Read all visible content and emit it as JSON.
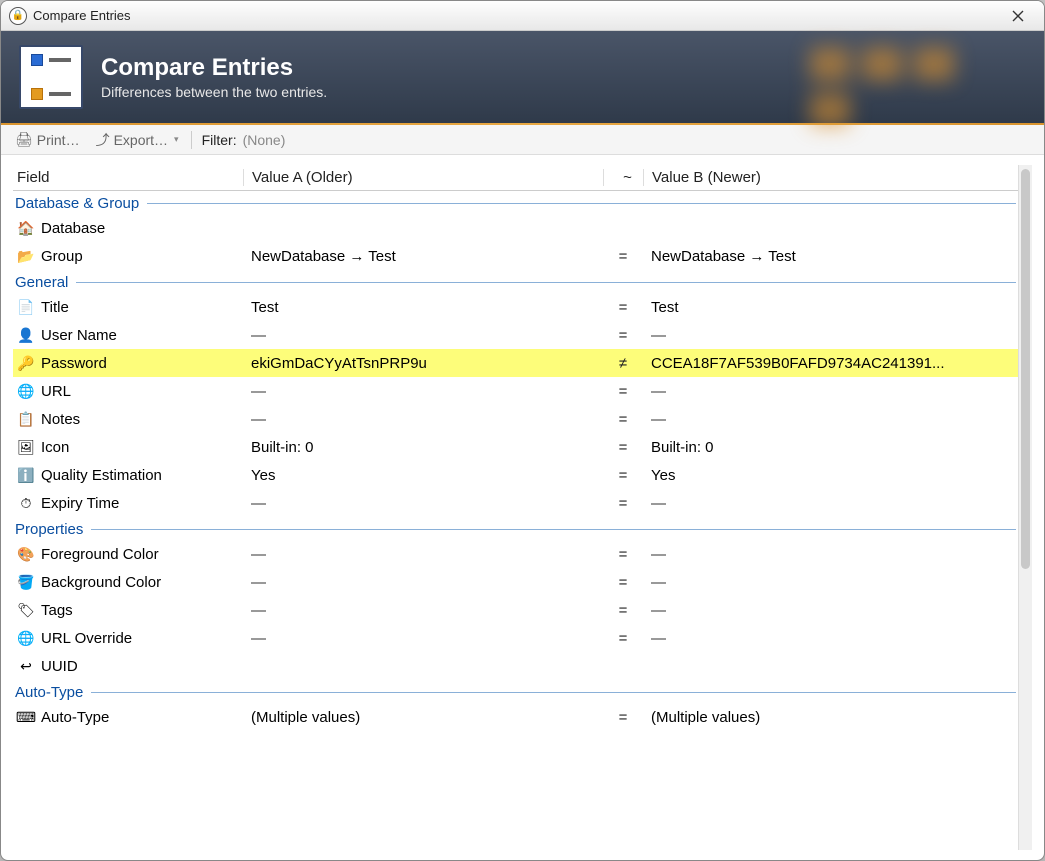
{
  "window": {
    "title": "Compare Entries"
  },
  "banner": {
    "title": "Compare Entries",
    "subtitle": "Differences between the two entries."
  },
  "toolbar": {
    "print_label": "Print…",
    "export_label": "Export…",
    "filter_label": "Filter:",
    "filter_value": "(None)"
  },
  "headers": {
    "field": "Field",
    "value_a": "Value A (Older)",
    "sym": "~",
    "value_b": "Value B (Newer)"
  },
  "sections": {
    "db_group": "Database & Group",
    "general": "General",
    "properties": "Properties",
    "autotype": "Auto-Type"
  },
  "rows": {
    "database": {
      "label": "Database",
      "a": "",
      "sym": "",
      "b": "",
      "icon": "🏠"
    },
    "group": {
      "label": "Group",
      "a": "NewDatabase → Test",
      "sym": "=",
      "b": "NewDatabase → Test",
      "icon": "📂"
    },
    "title": {
      "label": "Title",
      "a": "Test",
      "sym": "=",
      "b": "Test",
      "icon": "📄"
    },
    "username": {
      "label": "User Name",
      "a": "—",
      "sym": "=",
      "b": "—",
      "icon": "👤"
    },
    "password": {
      "label": "Password",
      "a": "ekiGmDaCYyAtTsnPRP9u",
      "sym": "≠",
      "b": "CCEA18F7AF539B0FAFD9734AC241391...",
      "icon": "🔑",
      "diff": true
    },
    "url": {
      "label": "URL",
      "a": "—",
      "sym": "=",
      "b": "—",
      "icon": "🌐"
    },
    "notes": {
      "label": "Notes",
      "a": "—",
      "sym": "=",
      "b": "—",
      "icon": "📋"
    },
    "iconrow": {
      "label": "Icon",
      "a": "Built-in: 0",
      "sym": "=",
      "b": "Built-in: 0",
      "icon": "🖼"
    },
    "quality": {
      "label": "Quality Estimation",
      "a": "Yes",
      "sym": "=",
      "b": "Yes",
      "icon": "ℹ"
    },
    "expiry": {
      "label": "Expiry Time",
      "a": "—",
      "sym": "=",
      "b": "—",
      "icon": "⏱"
    },
    "fgcolor": {
      "label": "Foreground Color",
      "a": "—",
      "sym": "=",
      "b": "—",
      "icon": "🎨"
    },
    "bgcolor": {
      "label": "Background Color",
      "a": "—",
      "sym": "=",
      "b": "—",
      "icon": "◧"
    },
    "tags": {
      "label": "Tags",
      "a": "—",
      "sym": "=",
      "b": "—",
      "icon": "🏷"
    },
    "urloverride": {
      "label": "URL Override",
      "a": "—",
      "sym": "=",
      "b": "—",
      "icon": "🌐"
    },
    "uuid": {
      "label": "UUID",
      "a": "",
      "sym": "",
      "b": "",
      "icon": "↩"
    },
    "autotype": {
      "label": "Auto-Type",
      "a": "(Multiple values)",
      "sym": "=",
      "b": "(Multiple values)",
      "icon": "⌨"
    }
  }
}
